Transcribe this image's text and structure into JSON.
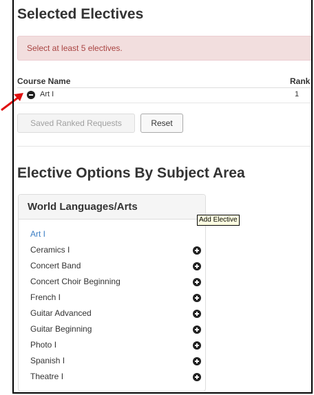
{
  "section_selected": {
    "title": "Selected Electives",
    "alert": "Select at least 5 electives.",
    "columns": {
      "course": "Course Name",
      "rank": "Rank"
    },
    "rows": [
      {
        "course": "Art I",
        "rank": "1"
      }
    ],
    "buttons": {
      "saved": "Saved Ranked Requests",
      "reset": "Reset"
    }
  },
  "section_options": {
    "title": "Elective Options By Subject Area",
    "panel_title": "World Languages/Arts",
    "tooltip": "Add Elective",
    "items": [
      "Art I",
      "Ceramics I",
      "Concert Band",
      "Concert Choir Beginning",
      "French I",
      "Guitar Advanced",
      "Guitar Beginning",
      "Photo I",
      "Spanish I",
      "Theatre I"
    ]
  },
  "colors": {
    "alert_bg": "#f2dede",
    "alert_text": "#a94442",
    "link": "#3a7dc4",
    "arrow": "#e01010"
  },
  "icons": {
    "remove": "minus-circle-icon",
    "add": "plus-circle-icon",
    "annotation": "red-arrow-icon"
  }
}
